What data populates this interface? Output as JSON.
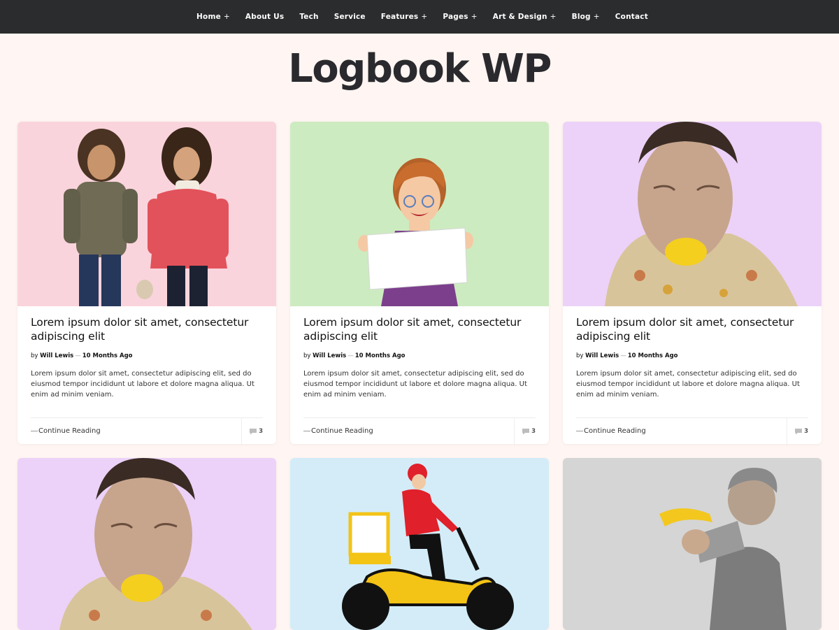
{
  "nav": {
    "items": [
      {
        "label": "Home",
        "has_children": true
      },
      {
        "label": "About Us",
        "has_children": false
      },
      {
        "label": "Tech",
        "has_children": false
      },
      {
        "label": "Service",
        "has_children": false
      },
      {
        "label": "Features",
        "has_children": true
      },
      {
        "label": "Pages",
        "has_children": true
      },
      {
        "label": "Art & Design",
        "has_children": true
      },
      {
        "label": "Blog",
        "has_children": true
      },
      {
        "label": "Contact",
        "has_children": false
      }
    ],
    "plus": "+"
  },
  "site": {
    "title": "Logbook WP"
  },
  "posts": [
    {
      "image": "two-children-image",
      "bg": "#fad4dc",
      "title": "Lorem ipsum dolor sit amet, consectetur adipiscing elit",
      "by": "by",
      "author": "Will Lewis",
      "sep": "—",
      "date": "10 Months Ago",
      "excerpt": "Lorem ipsum dolor sit amet, consectetur adipiscing elit, sed do eiusmod tempor incididunt ut labore et dolore magna aliqua. Ut enim ad minim veniam.",
      "more": "Continue Reading",
      "comments": "3"
    },
    {
      "image": "woman-holding-sign-illustration",
      "bg": "#cdebc0",
      "title": "Lorem ipsum dolor sit amet, consectetur adipiscing elit",
      "by": "by",
      "author": "Will Lewis",
      "sep": "—",
      "date": "10 Months Ago",
      "excerpt": "Lorem ipsum dolor sit amet, consectetur adipiscing elit, sed do eiusmod tempor incididunt ut labore et dolore magna aliqua. Ut enim ad minim veniam.",
      "more": "Continue Reading",
      "comments": "3"
    },
    {
      "image": "man-biting-lemon-image",
      "bg": "#ecd2f8",
      "title": "Lorem ipsum dolor sit amet, consectetur adipiscing elit",
      "by": "by",
      "author": "Will Lewis",
      "sep": "—",
      "date": "10 Months Ago",
      "excerpt": "Lorem ipsum dolor sit amet, consectetur adipiscing elit, sed do eiusmod tempor incididunt ut labore et dolore magna aliqua. Ut enim ad minim veniam.",
      "more": "Continue Reading",
      "comments": "3"
    },
    {
      "image": "man-biting-lemon-image",
      "bg": "#ecd2f8"
    },
    {
      "image": "delivery-scooter-illustration",
      "bg": "#d3ecf8"
    },
    {
      "image": "man-with-banana-image",
      "bg": "#d5d5d5"
    }
  ]
}
